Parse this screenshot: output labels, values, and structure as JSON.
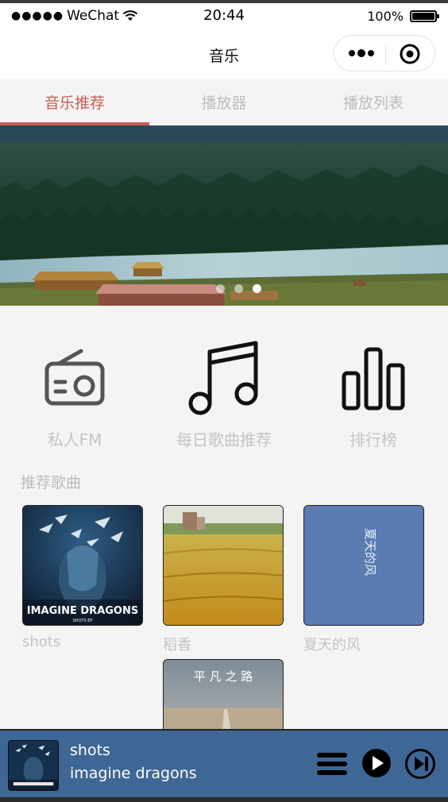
{
  "status_bar": {
    "carrier": "WeChat",
    "time": "20:44",
    "battery": "100%"
  },
  "nav": {
    "title": "音乐"
  },
  "tabs": [
    {
      "label": "音乐推荐",
      "active": true
    },
    {
      "label": "播放器",
      "active": false
    },
    {
      "label": "播放列表",
      "active": false
    }
  ],
  "banner": {
    "slide_count": 3,
    "active_slide": 3
  },
  "features": [
    {
      "label": "私人FM",
      "icon": "radio-icon"
    },
    {
      "label": "每日歌曲推荐",
      "icon": "music-note-icon"
    },
    {
      "label": "排行榜",
      "icon": "bar-chart-icon"
    }
  ],
  "section_title": "推荐歌曲",
  "songs": [
    {
      "name": "shots",
      "cover": "imagine-dragons-shots-cover",
      "cover_text": "IMAGINE DRAGONS",
      "cover_subtext": "SHOTS EP"
    },
    {
      "name": "稻香",
      "cover": "rice-field-cover"
    },
    {
      "name": "夏天的风",
      "cover": "summer-wind-cover",
      "cover_text": "夏天的风"
    },
    {
      "name": "",
      "cover": "ping-fan-zhi-lu-cover",
      "cover_text": "平 凡 之 路"
    }
  ],
  "player": {
    "title": "shots",
    "artist": "imagine dragons",
    "colors": {
      "background": "#3f6795"
    }
  },
  "colors": {
    "accent": "#c65e54",
    "muted_text": "#c4c4c4",
    "page_bg": "#f4f4f4"
  }
}
